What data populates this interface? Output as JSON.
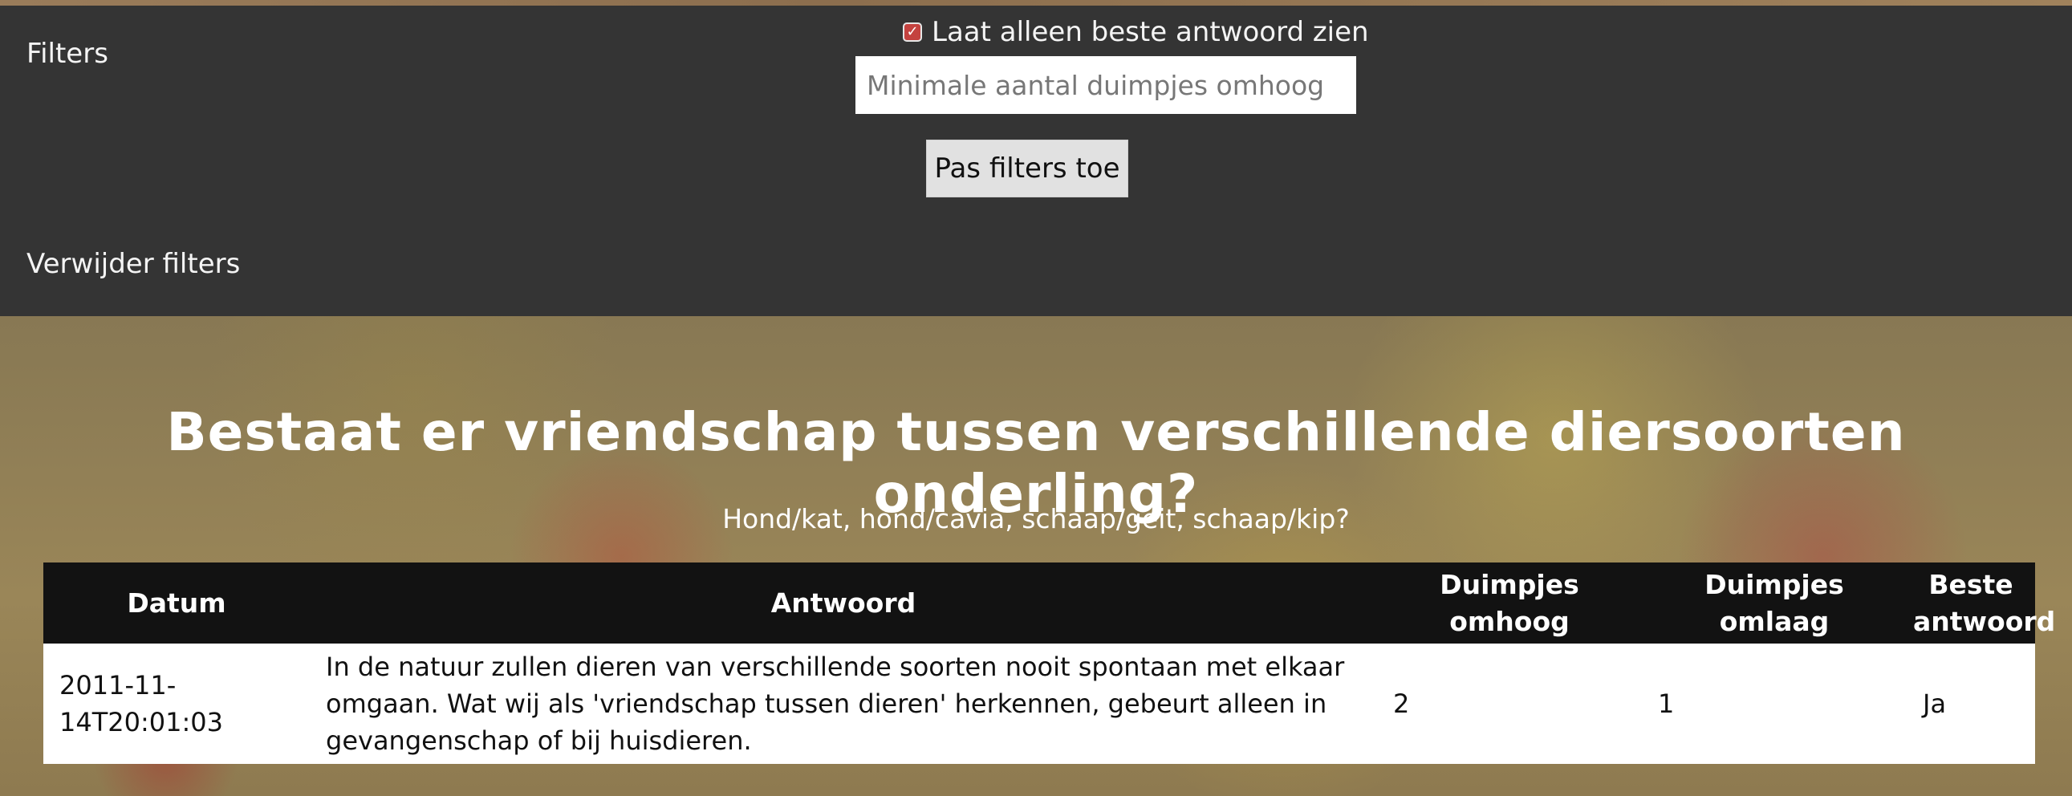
{
  "filters": {
    "title": "Filters",
    "best_answer_checkbox": {
      "label": "Laat alleen beste antwoord zien",
      "checked": true
    },
    "min_thumbs_input": {
      "placeholder": "Minimale aantal duimpjes omhoog",
      "value": ""
    },
    "apply_button": "Pas filters toe",
    "remove_link": "Verwijder filters"
  },
  "question": {
    "title": "Bestaat er vriendschap tussen verschillende diersoorten onderling?",
    "subtitle": "Hond/kat, hond/cavia, schaap/geit, schaap/kip?"
  },
  "table": {
    "headers": {
      "datum": "Datum",
      "antwoord": "Antwoord",
      "omhoog": "Duimpjes omhoog",
      "omlaag": "Duimpjes omlaag",
      "beste": "Beste antwoord"
    },
    "rows": [
      {
        "datum": "2011-11-14T20:01:03",
        "antwoord": "In de natuur zullen dieren van verschillende soorten nooit spontaan met elkaar omgaan. Wat wij als 'vriendschap tussen dieren' herkennen, gebeurt alleen in gevangenschap of bij huisdieren.",
        "omhoog": "2",
        "omlaag": "1",
        "beste": "Ja"
      }
    ]
  },
  "colors": {
    "filterbar_bg": "#343434",
    "table_header_bg": "#121212",
    "checkbox_accent": "#c4423f"
  }
}
